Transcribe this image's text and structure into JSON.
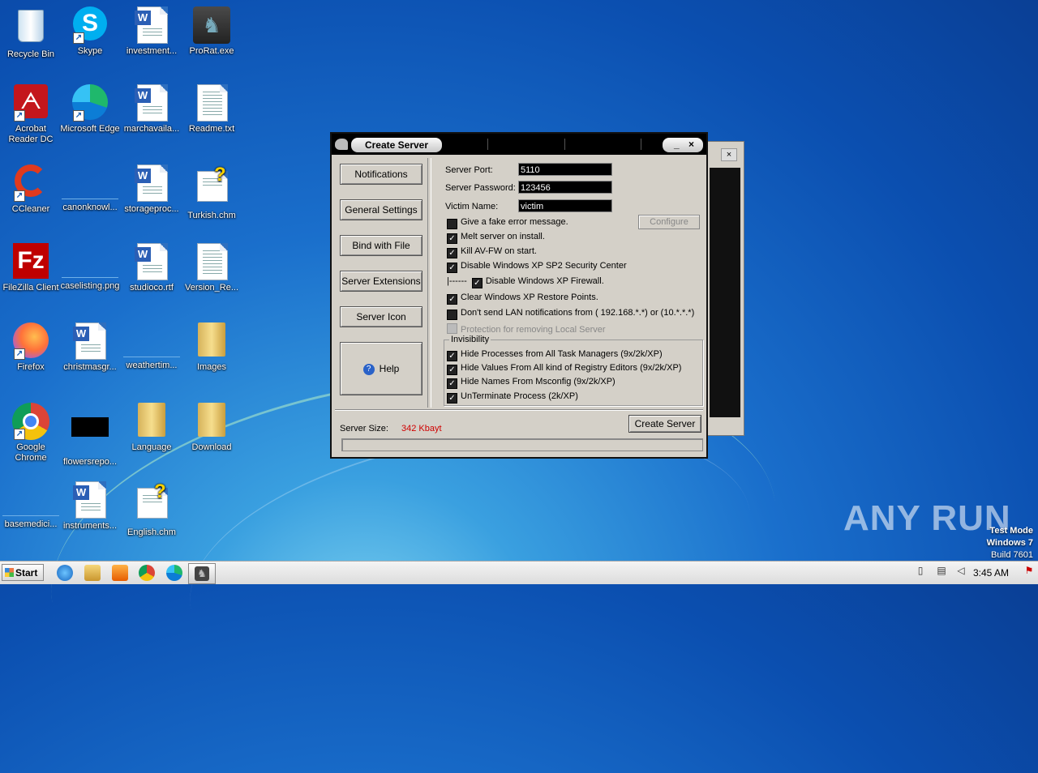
{
  "desktop": {
    "icons": [
      {
        "label": "Recycle Bin"
      },
      {
        "label": "Skype"
      },
      {
        "label": "investment..."
      },
      {
        "label": "ProRat.exe"
      },
      {
        "label": "Acrobat Reader DC"
      },
      {
        "label": "Microsoft Edge"
      },
      {
        "label": "marchavaila..."
      },
      {
        "label": "Readme.txt"
      },
      {
        "label": "CCleaner"
      },
      {
        "label": "canonknowl..."
      },
      {
        "label": "storageproc..."
      },
      {
        "label": "Turkish.chm"
      },
      {
        "label": "FileZilla Client"
      },
      {
        "label": "caselisting.png"
      },
      {
        "label": "studioco.rtf"
      },
      {
        "label": "Version_Re..."
      },
      {
        "label": "Firefox"
      },
      {
        "label": "christmasgr..."
      },
      {
        "label": "weathertim..."
      },
      {
        "label": "Images"
      },
      {
        "label": "Google Chrome"
      },
      {
        "label": "flowersrepo..."
      },
      {
        "label": "Language"
      },
      {
        "label": "Download"
      },
      {
        "label": "basemedici..."
      },
      {
        "label": "instruments..."
      },
      {
        "label": "English.chm"
      }
    ]
  },
  "window": {
    "title": "Create Server",
    "minimize": "_",
    "close": "×",
    "nav": [
      "Notifications",
      "General Settings",
      "Bind with File",
      "Server Extensions",
      "Server Icon"
    ],
    "help": "Help",
    "fields": {
      "port_label": "Server Port:",
      "port_value": "5110",
      "password_label": "Server Password:",
      "password_value": "123456",
      "victim_label": "Victim Name:",
      "victim_value": "victim"
    },
    "configure": "Configure",
    "options": [
      {
        "label": "Give a fake error message.",
        "checked": false
      },
      {
        "label": "Melt server on install.",
        "checked": true
      },
      {
        "label": "Kill AV-FW on start.",
        "checked": true
      },
      {
        "label": "Disable Windows XP SP2 Security Center",
        "checked": true
      },
      {
        "label": "Disable Windows XP Firewall.",
        "checked": true,
        "prefix": "|------"
      },
      {
        "label": "Clear Windows XP Restore Points.",
        "checked": true
      },
      {
        "label": "Don't send LAN notifications from ( 192.168.*.*) or (10.*.*.*)",
        "checked": false
      },
      {
        "label": "Protection for removing Local Server",
        "checked": false,
        "disabled": true
      }
    ],
    "invisibility": {
      "legend": "Invisibility",
      "options": [
        {
          "label": "Hide Processes from All Task Managers  (9x/2k/XP)",
          "checked": true
        },
        {
          "label": "Hide Values From All kind of Registry Editors (9x/2k/XP)",
          "checked": true
        },
        {
          "label": "Hide Names From Msconfig  (9x/2k/XP)",
          "checked": true
        },
        {
          "label": "UnTerminate Process (2k/XP)",
          "checked": true
        }
      ]
    },
    "server_size_label": "Server Size:",
    "server_size_value": "342 Kbayt",
    "server_size_color": "#d00000",
    "create_button": "Create Server"
  },
  "back_window": {
    "close": "×"
  },
  "watermark": "ANY RUN",
  "testmode": {
    "line1": "Test Mode",
    "line2": "Windows 7",
    "line3": "Build 7601"
  },
  "taskbar": {
    "start": "Start",
    "clock": "3:45 AM"
  }
}
